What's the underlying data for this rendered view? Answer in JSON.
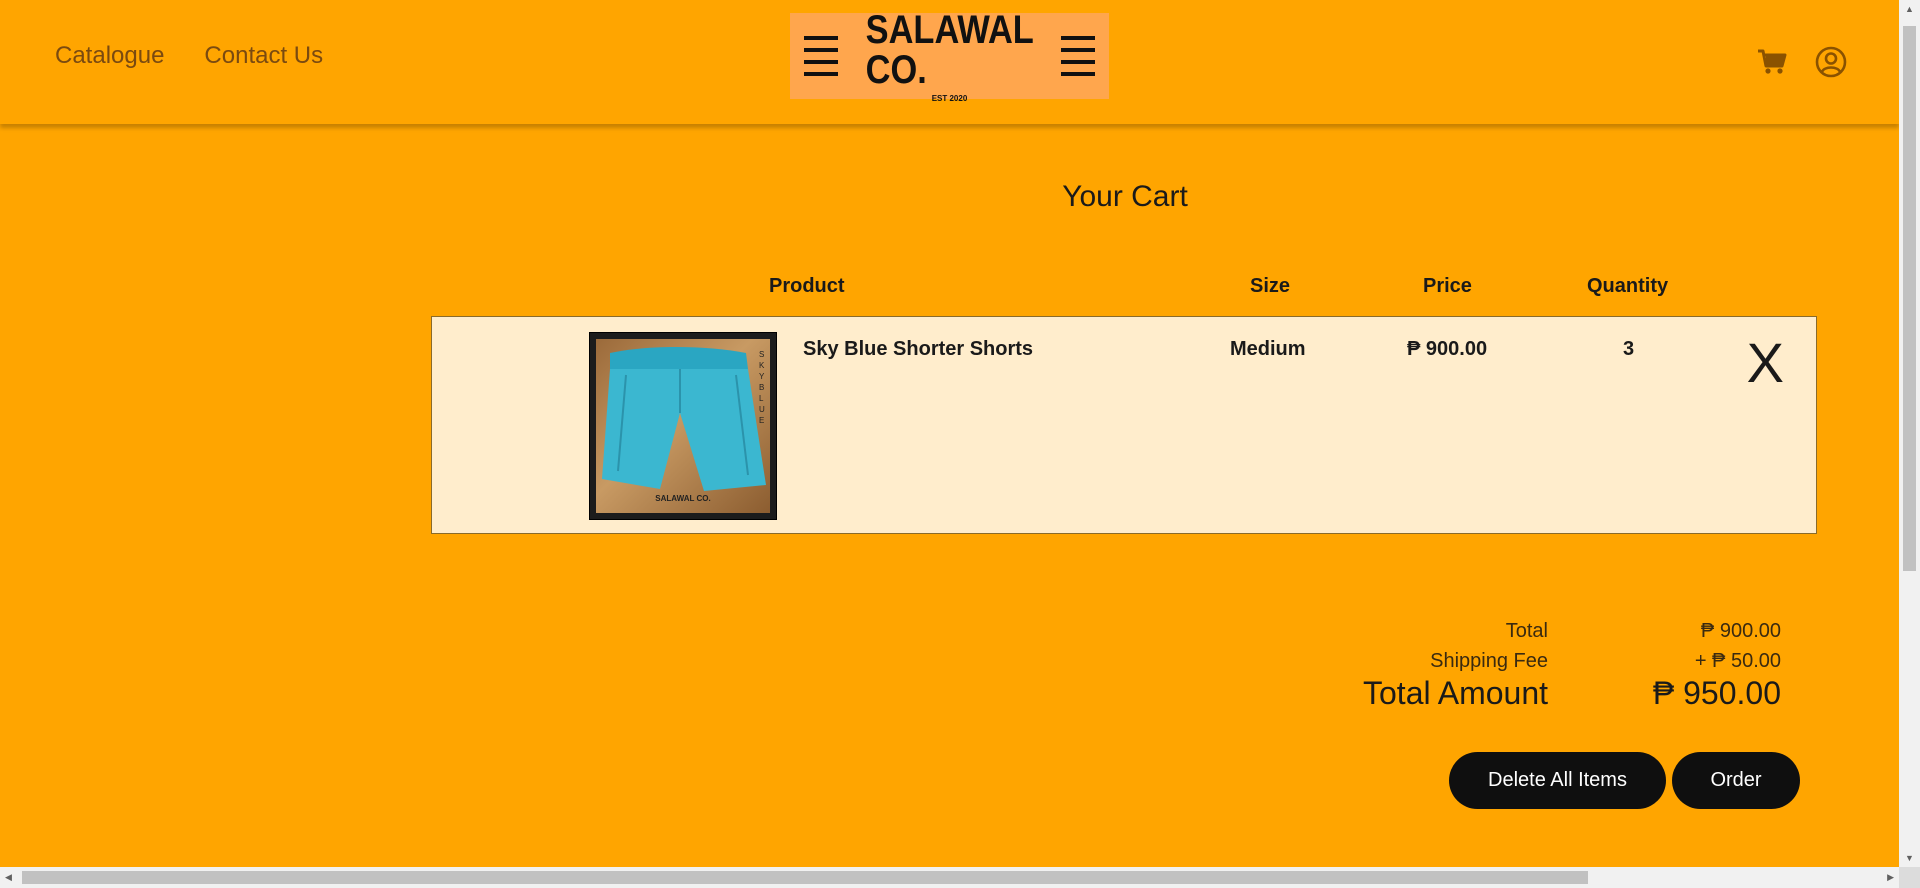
{
  "nav": {
    "links": [
      "Catalogue",
      "Contact Us"
    ]
  },
  "logo": {
    "name": "SALAWAL CO.",
    "est": "EST 2020"
  },
  "header_icons": [
    "cart-icon",
    "user-circle-icon"
  ],
  "cart": {
    "title": "Your Cart",
    "columns": {
      "product": "Product",
      "size": "Size",
      "price": "Price",
      "quantity": "Quantity"
    },
    "items": [
      {
        "name": "Sky Blue Shorter Shorts",
        "size": "Medium",
        "price": "₱ 900.00",
        "quantity": "3",
        "remove": "X",
        "image_label": "SALAWAL CO.",
        "image_side_text": "SKY BLUE"
      }
    ]
  },
  "summary": {
    "total_label": "Total",
    "total_value": "₱ 900.00",
    "shipping_label": "Shipping Fee",
    "shipping_value": "+ ₱ 50.00",
    "amount_label": "Total Amount",
    "amount_value": "₱ 950.00"
  },
  "actions": {
    "delete_all": "Delete All Items",
    "order": "Order"
  },
  "colors": {
    "background": "#FFA500",
    "row": "#FFEDCC",
    "button": "#0f0f0f",
    "logo_bg": "#FFA64D",
    "shorts": "#3BB7D0"
  }
}
